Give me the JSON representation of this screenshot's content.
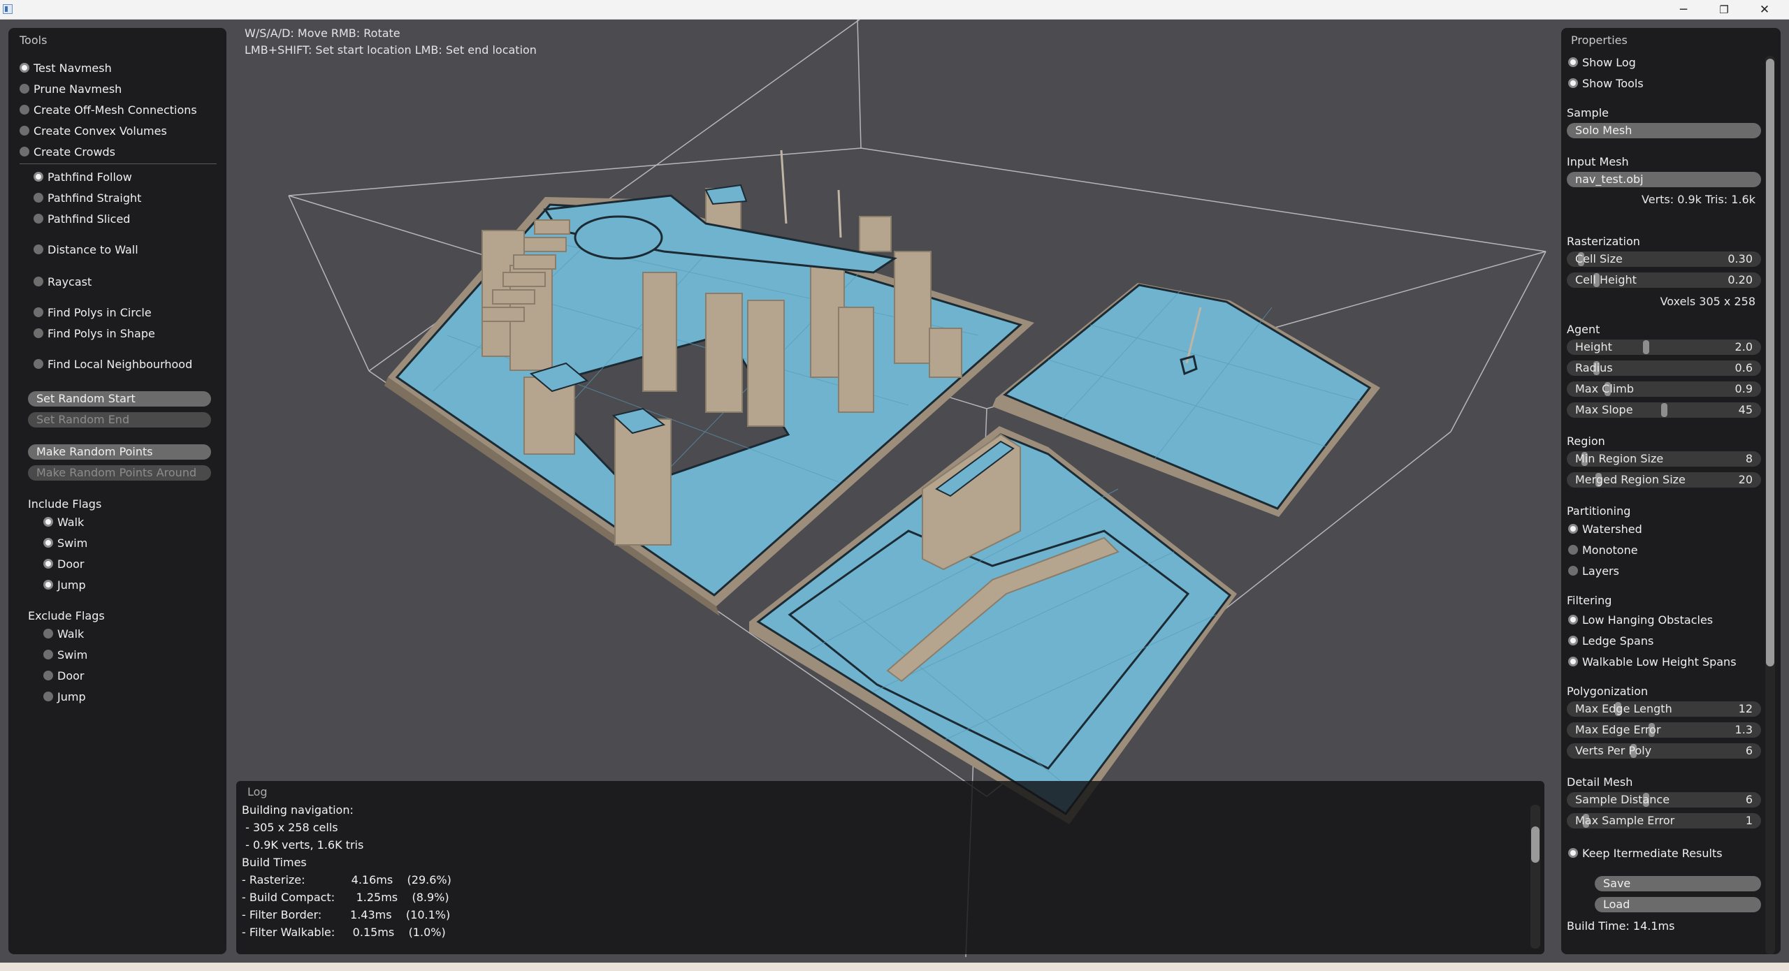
{
  "window": {
    "minimize_glyph": "─",
    "restore_glyph": "❐",
    "close_glyph": "✕"
  },
  "help": {
    "line1": "W/S/A/D: Move  RMB: Rotate",
    "line2": "LMB+SHIFT: Set start location  LMB: Set end location"
  },
  "tools": {
    "title": "Tools",
    "modes": [
      {
        "label": "Test Navmesh",
        "checked": true
      },
      {
        "label": "Prune Navmesh",
        "checked": false
      },
      {
        "label": "Create Off-Mesh Connections",
        "checked": false
      },
      {
        "label": "Create Convex Volumes",
        "checked": false
      },
      {
        "label": "Create Crowds",
        "checked": false
      }
    ],
    "tests": [
      {
        "label": "Pathfind Follow",
        "checked": true
      },
      {
        "label": "Pathfind Straight",
        "checked": false
      },
      {
        "label": "Pathfind Sliced",
        "checked": false
      },
      {
        "label": "Distance to Wall",
        "checked": false
      },
      {
        "label": "Raycast",
        "checked": false
      },
      {
        "label": "Find Polys in Circle",
        "checked": false
      },
      {
        "label": "Find Polys in Shape",
        "checked": false
      },
      {
        "label": "Find Local Neighbourhood",
        "checked": false
      }
    ],
    "buttons": [
      {
        "label": "Set Random Start",
        "enabled": true
      },
      {
        "label": "Set Random End",
        "enabled": false
      },
      {
        "label": "Make Random Points",
        "enabled": true
      },
      {
        "label": "Make Random Points Around",
        "enabled": false
      }
    ],
    "include_title": "Include Flags",
    "include_flags": [
      {
        "label": "Walk",
        "checked": true
      },
      {
        "label": "Swim",
        "checked": true
      },
      {
        "label": "Door",
        "checked": true
      },
      {
        "label": "Jump",
        "checked": true
      }
    ],
    "exclude_title": "Exclude Flags",
    "exclude_flags": [
      {
        "label": "Walk",
        "checked": false
      },
      {
        "label": "Swim",
        "checked": false
      },
      {
        "label": "Door",
        "checked": false
      },
      {
        "label": "Jump",
        "checked": false
      }
    ]
  },
  "log": {
    "title": "Log",
    "lines": [
      "Building navigation:",
      " - 305 x 258 cells",
      " - 0.9K verts, 1.6K tris",
      "Build Times",
      "- Rasterize:             4.16ms    (29.6%)",
      "- Build Compact:      1.25ms    (8.9%)",
      "- Filter Border:        1.43ms    (10.1%)",
      "- Filter Walkable:     0.15ms    (1.0%)"
    ],
    "scroll": 0.18
  },
  "properties": {
    "title": "Properties",
    "show_log": {
      "label": "Show Log",
      "checked": true
    },
    "show_tools": {
      "label": "Show Tools",
      "checked": true
    },
    "sample_title": "Sample",
    "sample_value": "Solo Mesh",
    "input_mesh_title": "Input Mesh",
    "input_mesh_value": "nav_test.obj",
    "mesh_stats": "Verts: 0.9k  Tris: 1.6k",
    "rasterization_title": "Rasterization",
    "cell_size": {
      "label": "Cell Size",
      "value": "0.30",
      "fraction": 0.03
    },
    "cell_height": {
      "label": "Cell Height",
      "value": "0.20",
      "fraction": 0.12
    },
    "voxels": "Voxels  305 x 258",
    "agent_title": "Agent",
    "height": {
      "label": "Height",
      "value": "2.0",
      "fraction": 0.4
    },
    "radius": {
      "label": "Radius",
      "value": "0.6",
      "fraction": 0.12
    },
    "max_climb": {
      "label": "Max Climb",
      "value": "0.9",
      "fraction": 0.18
    },
    "max_slope": {
      "label": "Max Slope",
      "value": "45",
      "fraction": 0.5
    },
    "region_title": "Region",
    "min_region": {
      "label": "Min Region Size",
      "value": "8",
      "fraction": 0.05
    },
    "merged_region": {
      "label": "Merged Region Size",
      "value": "20",
      "fraction": 0.13
    },
    "partitioning_title": "Partitioning",
    "partitioning": [
      {
        "label": "Watershed",
        "checked": true
      },
      {
        "label": "Monotone",
        "checked": false
      },
      {
        "label": "Layers",
        "checked": false
      }
    ],
    "filtering_title": "Filtering",
    "filtering": [
      {
        "label": "Low Hanging Obstacles",
        "checked": true
      },
      {
        "label": "Ledge Spans",
        "checked": true
      },
      {
        "label": "Walkable Low Height Spans",
        "checked": true
      }
    ],
    "polygonization_title": "Polygonization",
    "max_edge_length": {
      "label": "Max Edge Length",
      "value": "12",
      "fraction": 0.24
    },
    "max_edge_error": {
      "label": "Max Edge Error",
      "value": "1.3",
      "fraction": 0.43
    },
    "verts_per_poly": {
      "label": "Verts Per Poly",
      "value": "6",
      "fraction": 0.33
    },
    "detail_title": "Detail Mesh",
    "sample_distance": {
      "label": "Sample Distance",
      "value": "6",
      "fraction": 0.4
    },
    "max_sample_error": {
      "label": "Max Sample Error",
      "value": "1",
      "fraction": 0.06
    },
    "keep_intermediate": {
      "label": "Keep Itermediate Results",
      "checked": true
    },
    "save_label": "Save",
    "load_label": "Load",
    "build_time": "Build Time: 14.1ms",
    "scroll": 0.0
  },
  "colors": {
    "background": "#4c4b50",
    "navmesh": "#6fb3cf",
    "geometry": "#b5a58e",
    "panel": "#121214"
  }
}
